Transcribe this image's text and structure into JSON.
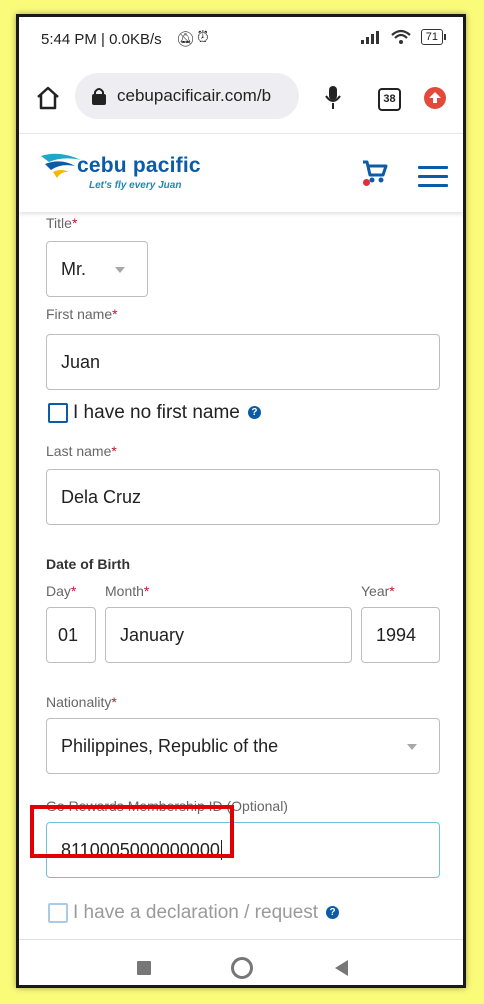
{
  "status_bar": {
    "time": "5:44 PM | 0.0KB/s",
    "battery": "71"
  },
  "browser": {
    "url": "cebupacificair.com/b",
    "tab_count": "38"
  },
  "site": {
    "logo_name": "cebu pacific",
    "logo_tagline": "Let's fly every Juan",
    "brand_color": "#0b5ba8",
    "required_color": "#c8102e"
  },
  "form": {
    "title_label": "Title",
    "title_value": "Mr.",
    "first_name_label": "First name",
    "first_name_value": "Juan",
    "no_first_name_label": "I have no first name",
    "last_name_label": "Last name",
    "last_name_value": "Dela Cruz",
    "dob_heading": "Date of Birth",
    "day_label": "Day",
    "day_value": "01",
    "month_label": "Month",
    "month_value": "January",
    "year_label": "Year",
    "year_value": "1994",
    "nationality_label": "Nationality",
    "nationality_value": "Philippines, Republic of the",
    "rewards_label": "Go Rewards Membership ID (Optional)",
    "rewards_value": "8110005000000000",
    "declaration_label": "I have a declaration / request",
    "required_mark": "*",
    "help_mark": "?"
  }
}
